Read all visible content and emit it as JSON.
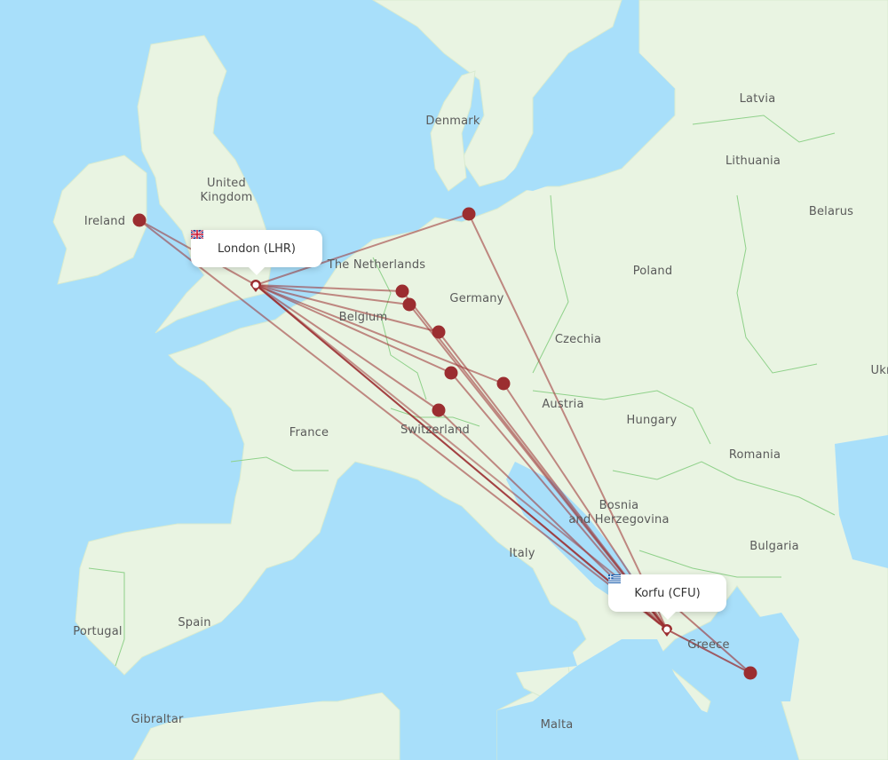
{
  "map": {
    "route_color": "#9b2d30",
    "marker_color": "#9b2d30",
    "water_color": "#a8dffa",
    "land_color": "#e9f4e2"
  },
  "origin": {
    "name": "London (LHR)",
    "flag": "uk-flag-icon"
  },
  "destination": {
    "name": "Korfu (CFU)",
    "flag": "greece-flag-icon"
  },
  "country_labels": [
    {
      "id": "ireland",
      "text": "Ireland"
    },
    {
      "id": "uk",
      "text": "United\nKingdom"
    },
    {
      "id": "netherlands",
      "text": "The Netherlands"
    },
    {
      "id": "belgium",
      "text": "Belgium"
    },
    {
      "id": "germany",
      "text": "Germany"
    },
    {
      "id": "denmark",
      "text": "Denmark"
    },
    {
      "id": "latvia",
      "text": "Latvia"
    },
    {
      "id": "lithuania",
      "text": "Lithuania"
    },
    {
      "id": "belarus",
      "text": "Belarus"
    },
    {
      "id": "poland",
      "text": "Poland"
    },
    {
      "id": "czechia",
      "text": "Czechia"
    },
    {
      "id": "ukraine",
      "text": "Ukr"
    },
    {
      "id": "austria",
      "text": "Austria"
    },
    {
      "id": "hungary",
      "text": "Hungary"
    },
    {
      "id": "romania",
      "text": "Romania"
    },
    {
      "id": "france",
      "text": "France"
    },
    {
      "id": "switzerland",
      "text": "Switzerland"
    },
    {
      "id": "bosnia",
      "text": "Bosnia\nand Herzegovina"
    },
    {
      "id": "italy",
      "text": "Italy"
    },
    {
      "id": "bulgaria",
      "text": "Bulgaria"
    },
    {
      "id": "greece",
      "text": "Greece"
    },
    {
      "id": "spain",
      "text": "Spain"
    },
    {
      "id": "portugal",
      "text": "Portugal"
    },
    {
      "id": "gibraltar",
      "text": "Gibraltar"
    },
    {
      "id": "malta",
      "text": "Malta"
    }
  ],
  "stopover_airports": [
    {
      "id": "dublin"
    },
    {
      "id": "hamburg"
    },
    {
      "id": "dusseldorf"
    },
    {
      "id": "cologne"
    },
    {
      "id": "frankfurt"
    },
    {
      "id": "stuttgart"
    },
    {
      "id": "munich"
    },
    {
      "id": "zurich"
    },
    {
      "id": "athens"
    }
  ]
}
